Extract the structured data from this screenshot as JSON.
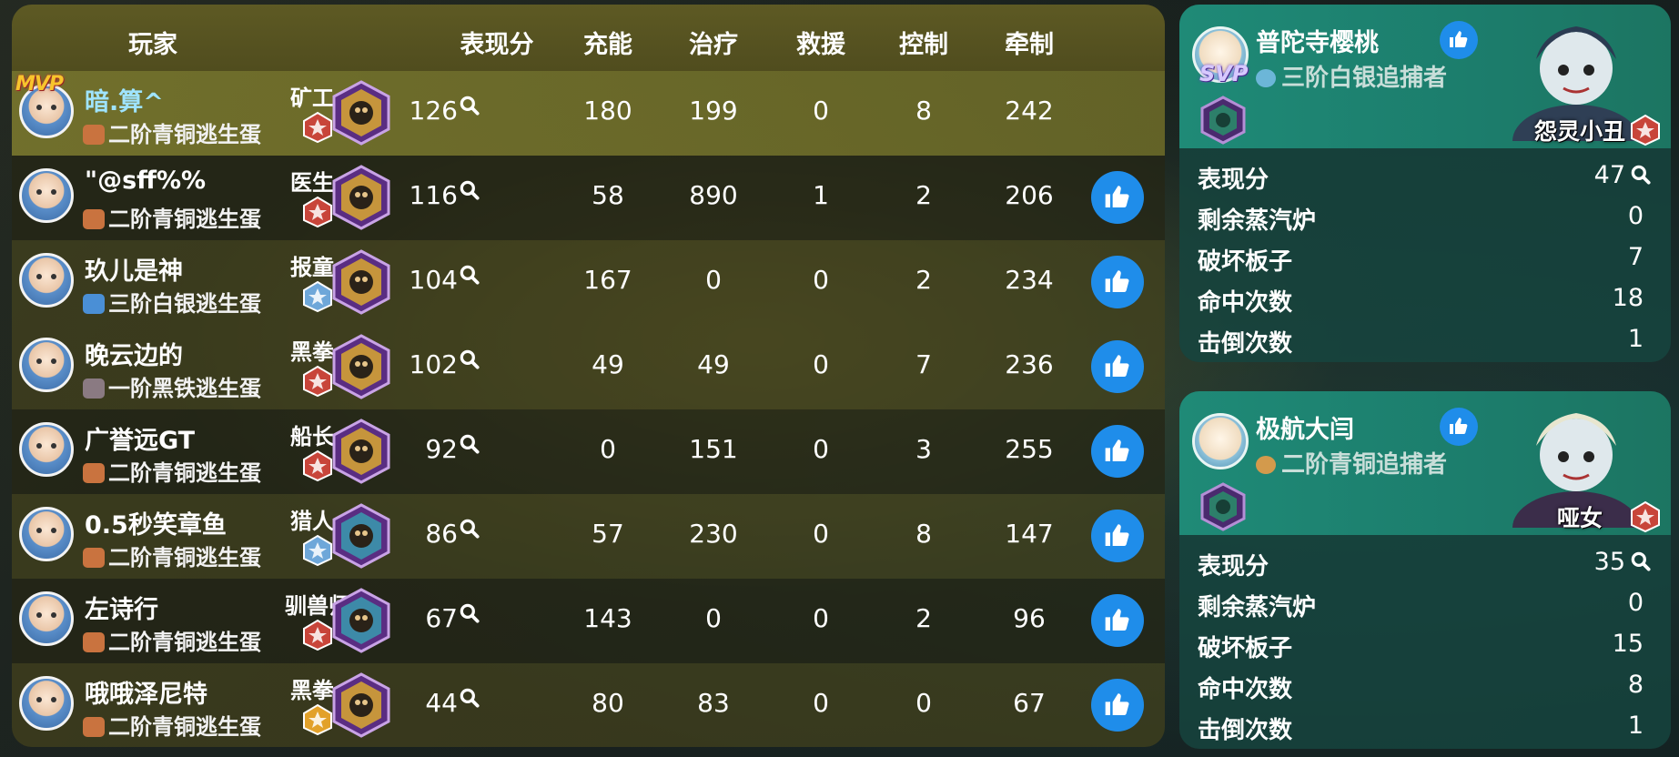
{
  "headers": {
    "player": "玩家",
    "score": "表现分",
    "charge": "充能",
    "heal": "治疗",
    "rescue": "救援",
    "control": "控制",
    "kite": "牵制"
  },
  "mvp_label": "MVP",
  "players": [
    {
      "name": "暗.算^",
      "rank": "二阶青铜逃生蛋",
      "role": "矿工",
      "score": "126",
      "charge": "180",
      "heal": "199",
      "rescue": "0",
      "control": "8",
      "kite": "242",
      "mvp": true
    },
    {
      "name": "\"@sff%%",
      "rank": "二阶青铜逃生蛋",
      "role": "医生",
      "score": "116",
      "charge": "58",
      "heal": "890",
      "rescue": "1",
      "control": "2",
      "kite": "206"
    },
    {
      "name": "玖儿是神",
      "rank": "三阶白银逃生蛋",
      "role": "报童",
      "score": "104",
      "charge": "167",
      "heal": "0",
      "rescue": "0",
      "control": "2",
      "kite": "234"
    },
    {
      "name": "晚云边的",
      "rank": "一阶黑铁逃生蛋",
      "role": "黑拳",
      "score": "102",
      "charge": "49",
      "heal": "49",
      "rescue": "0",
      "control": "7",
      "kite": "236"
    },
    {
      "name": "广誉远GT",
      "rank": "二阶青铜逃生蛋",
      "role": "船长",
      "score": "92",
      "charge": "0",
      "heal": "151",
      "rescue": "0",
      "control": "3",
      "kite": "255"
    },
    {
      "name": "0.5秒笑章鱼",
      "rank": "二阶青铜逃生蛋",
      "role": "猎人",
      "score": "86",
      "charge": "57",
      "heal": "230",
      "rescue": "0",
      "control": "8",
      "kite": "147"
    },
    {
      "name": "左诗行",
      "rank": "二阶青铜逃生蛋",
      "role": "驯兽师",
      "score": "67",
      "charge": "143",
      "heal": "0",
      "rescue": "0",
      "control": "2",
      "kite": "96"
    },
    {
      "name": "哦哦泽尼特",
      "rank": "二阶青铜逃生蛋",
      "role": "黑拳",
      "score": "44",
      "charge": "80",
      "heal": "83",
      "rescue": "0",
      "control": "0",
      "kite": "67"
    }
  ],
  "hunters": [
    {
      "svp_label": "SVP",
      "name": "普陀寺樱桃",
      "rank": "三阶白银追捕者",
      "character": "怨灵小丑",
      "stats": [
        {
          "label": "表现分",
          "value": "47"
        },
        {
          "label": "剩余蒸汽炉",
          "value": "0"
        },
        {
          "label": "破坏板子",
          "value": "7"
        },
        {
          "label": "命中次数",
          "value": "18"
        },
        {
          "label": "击倒次数",
          "value": "1"
        }
      ]
    },
    {
      "name": "极航大闫",
      "rank": "二阶青铜追捕者",
      "character": "哑女",
      "stats": [
        {
          "label": "表现分",
          "value": "35"
        },
        {
          "label": "剩余蒸汽炉",
          "value": "0"
        },
        {
          "label": "破坏板子",
          "value": "15"
        },
        {
          "label": "命中次数",
          "value": "8"
        },
        {
          "label": "击倒次数",
          "value": "1"
        }
      ]
    }
  ],
  "icons": {
    "like": "thumbs-up-icon",
    "search": "magnifier-icon",
    "talent": "talent-emblem-icon",
    "role_badge": "role-badge-icon"
  },
  "colors": {
    "like_blue": "#1f8dea",
    "mvp_row": "#76752d",
    "hunter_panel": "#1f8a77",
    "highlight_name": "#9fe4ff"
  }
}
